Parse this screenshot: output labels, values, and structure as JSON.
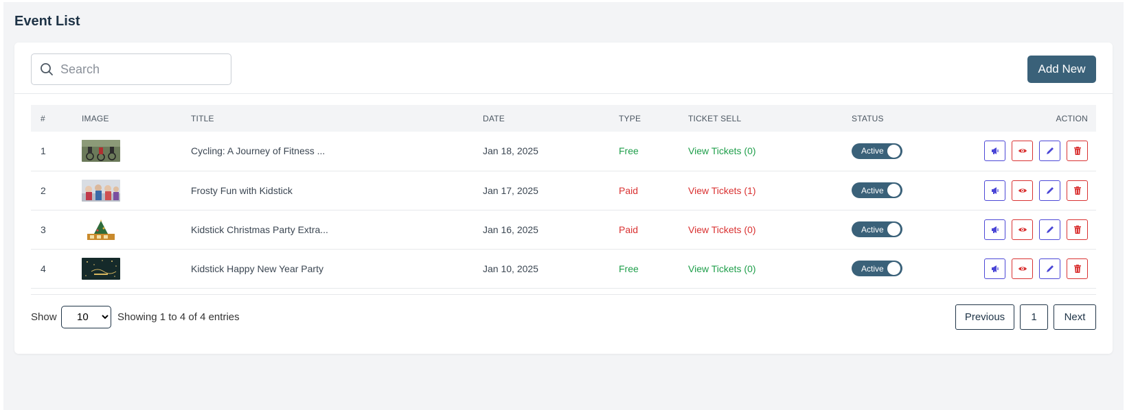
{
  "page": {
    "title": "Event List"
  },
  "toolbar": {
    "search_placeholder": "Search",
    "add_new_label": "Add New"
  },
  "table": {
    "headers": {
      "num": "#",
      "image": "IMAGE",
      "title": "TITLE",
      "date": "DATE",
      "type": "TYPE",
      "ticket_sell": "TICKET SELL",
      "status": "STATUS",
      "action": "ACTION"
    },
    "rows": [
      {
        "num": "1",
        "title": "Cycling: A Journey of Fitness ...",
        "date": "Jan 18, 2025",
        "type": "Free",
        "tickets": "View Tickets (0)",
        "status": "Active",
        "color": "#1e9e4a"
      },
      {
        "num": "2",
        "title": "Frosty Fun with Kidstick",
        "date": "Jan 17, 2025",
        "type": "Paid",
        "tickets": "View Tickets (1)",
        "status": "Active",
        "color": "#d93030"
      },
      {
        "num": "3",
        "title": "Kidstick Christmas Party Extra...",
        "date": "Jan 16, 2025",
        "type": "Paid",
        "tickets": "View Tickets (0)",
        "status": "Active",
        "color": "#d93030"
      },
      {
        "num": "4",
        "title": "Kidstick Happy New Year Party",
        "date": "Jan 10, 2025",
        "type": "Free",
        "tickets": "View Tickets (0)",
        "status": "Active",
        "color": "#1e9e4a"
      }
    ],
    "action_icons": [
      "megaphone-icon",
      "eye-icon",
      "pencil-icon",
      "trash-icon"
    ]
  },
  "footer": {
    "show_label": "Show",
    "page_size": "10",
    "page_size_options": [
      "10"
    ],
    "entries_info": "Showing 1 to 4 of 4 entries",
    "previous_label": "Previous",
    "current_page": "1",
    "next_label": "Next"
  },
  "colors": {
    "primary": "#3a6179",
    "free": "#1e9e4a",
    "paid": "#d93030",
    "action_blue": "#4a46d6",
    "action_red": "#d93030"
  }
}
